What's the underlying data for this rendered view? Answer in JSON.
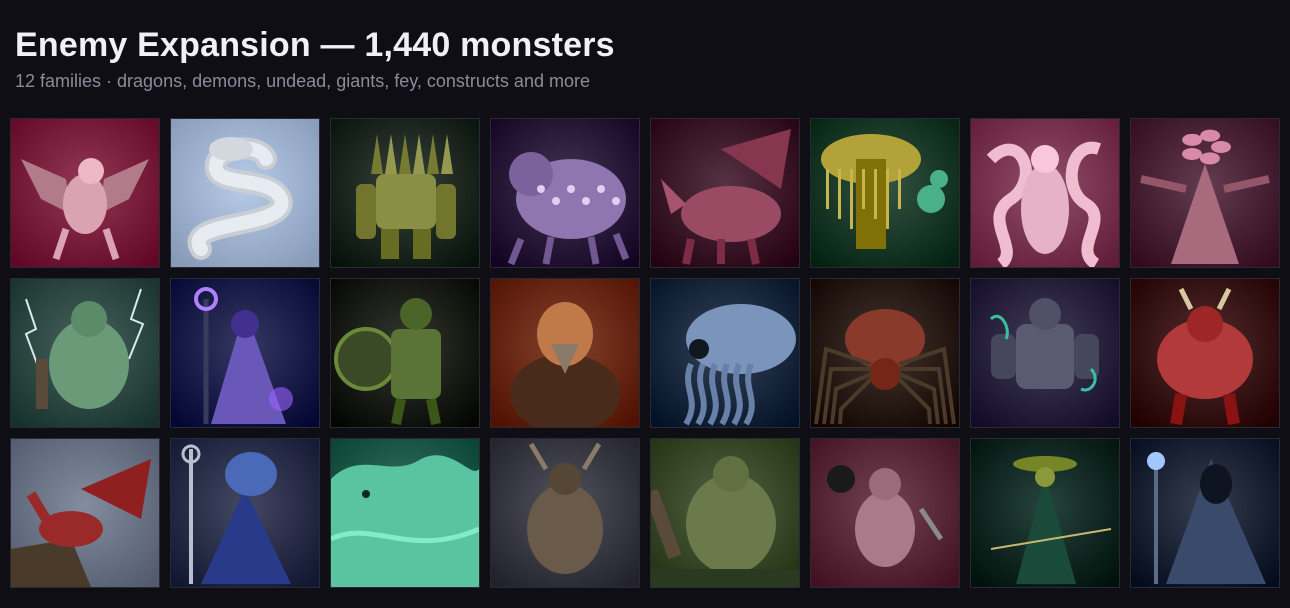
{
  "header": {
    "title": "Enemy Expansion — 1,440 monsters",
    "subtitle": "12 families · dragons, demons, undead, giants, fey, constructs and more"
  },
  "monsters": [
    {
      "name": "winged-gargoyle-icon",
      "bg": "#7a1f3e",
      "fg": "#d9a3b2",
      "kind": "winged"
    },
    {
      "name": "serpent-icon",
      "bg": "#9fb3d1",
      "fg": "#e6ecf2",
      "kind": "serpent"
    },
    {
      "name": "crystal-golem-icon",
      "bg": "#1f2a22",
      "fg": "#8a8f45",
      "kind": "golem"
    },
    {
      "name": "eldritch-horror-icon",
      "bg": "#2a1c3a",
      "fg": "#8f76b0",
      "kind": "beast"
    },
    {
      "name": "crimson-dragon-icon",
      "bg": "#3d1a2a",
      "fg": "#9b4a63",
      "kind": "dragon"
    },
    {
      "name": "mushroom-creature-icon",
      "bg": "#1c3a2a",
      "fg": "#b3a23a",
      "kind": "mushroom"
    },
    {
      "name": "pink-spirit-icon",
      "bg": "#7a3552",
      "fg": "#f0bcd0",
      "kind": "spirit"
    },
    {
      "name": "flower-treant-icon",
      "bg": "#4a2436",
      "fg": "#a86a7d",
      "kind": "treant"
    },
    {
      "name": "storm-troll-icon",
      "bg": "#2f4a44",
      "fg": "#6a9a78",
      "kind": "troll"
    },
    {
      "name": "dark-sorceress-icon",
      "bg": "#1c1f4a",
      "fg": "#6a58b8",
      "kind": "mage"
    },
    {
      "name": "orc-warrior-icon",
      "bg": "#1c1f18",
      "fg": "#5a7336",
      "kind": "warrior"
    },
    {
      "name": "ancient-elder-icon",
      "bg": "#6a2a14",
      "fg": "#c07a4a",
      "kind": "elder"
    },
    {
      "name": "deep-kraken-icon",
      "bg": "#1c2a40",
      "fg": "#7a94bb",
      "kind": "kraken"
    },
    {
      "name": "giant-spider-icon",
      "bg": "#2a1c14",
      "fg": "#8a3a2a",
      "kind": "spider"
    },
    {
      "name": "armored-knight-icon",
      "bg": "#2a2440",
      "fg": "#5a5a70",
      "kind": "knight"
    },
    {
      "name": "red-demon-icon",
      "bg": "#3a1418",
      "fg": "#b33a3a",
      "kind": "demon"
    },
    {
      "name": "cliff-dragon-icon",
      "bg": "#6a7486",
      "fg": "#9a2a2a",
      "kind": "dragon2"
    },
    {
      "name": "fish-priest-icon",
      "bg": "#2a2f4a",
      "fg": "#4a6ab8",
      "kind": "fishman"
    },
    {
      "name": "water-elemental-icon",
      "bg": "#1f5a4a",
      "fg": "#5ac3a0",
      "kind": "wave"
    },
    {
      "name": "horned-beast-icon",
      "bg": "#3a3a44",
      "fg": "#6a5a4a",
      "kind": "horned"
    },
    {
      "name": "swamp-ogre-icon",
      "bg": "#3a4a2a",
      "fg": "#6a7a4a",
      "kind": "ogre"
    },
    {
      "name": "goblin-bomber-icon",
      "bg": "#5a2a3a",
      "fg": "#a87a8a",
      "kind": "goblin"
    },
    {
      "name": "green-ranger-icon",
      "bg": "#0e2a24",
      "fg": "#8a9a3a",
      "kind": "ranger"
    },
    {
      "name": "hooded-wraith-icon",
      "bg": "#1c2436",
      "fg": "#3a4a6a",
      "kind": "wraith"
    }
  ]
}
